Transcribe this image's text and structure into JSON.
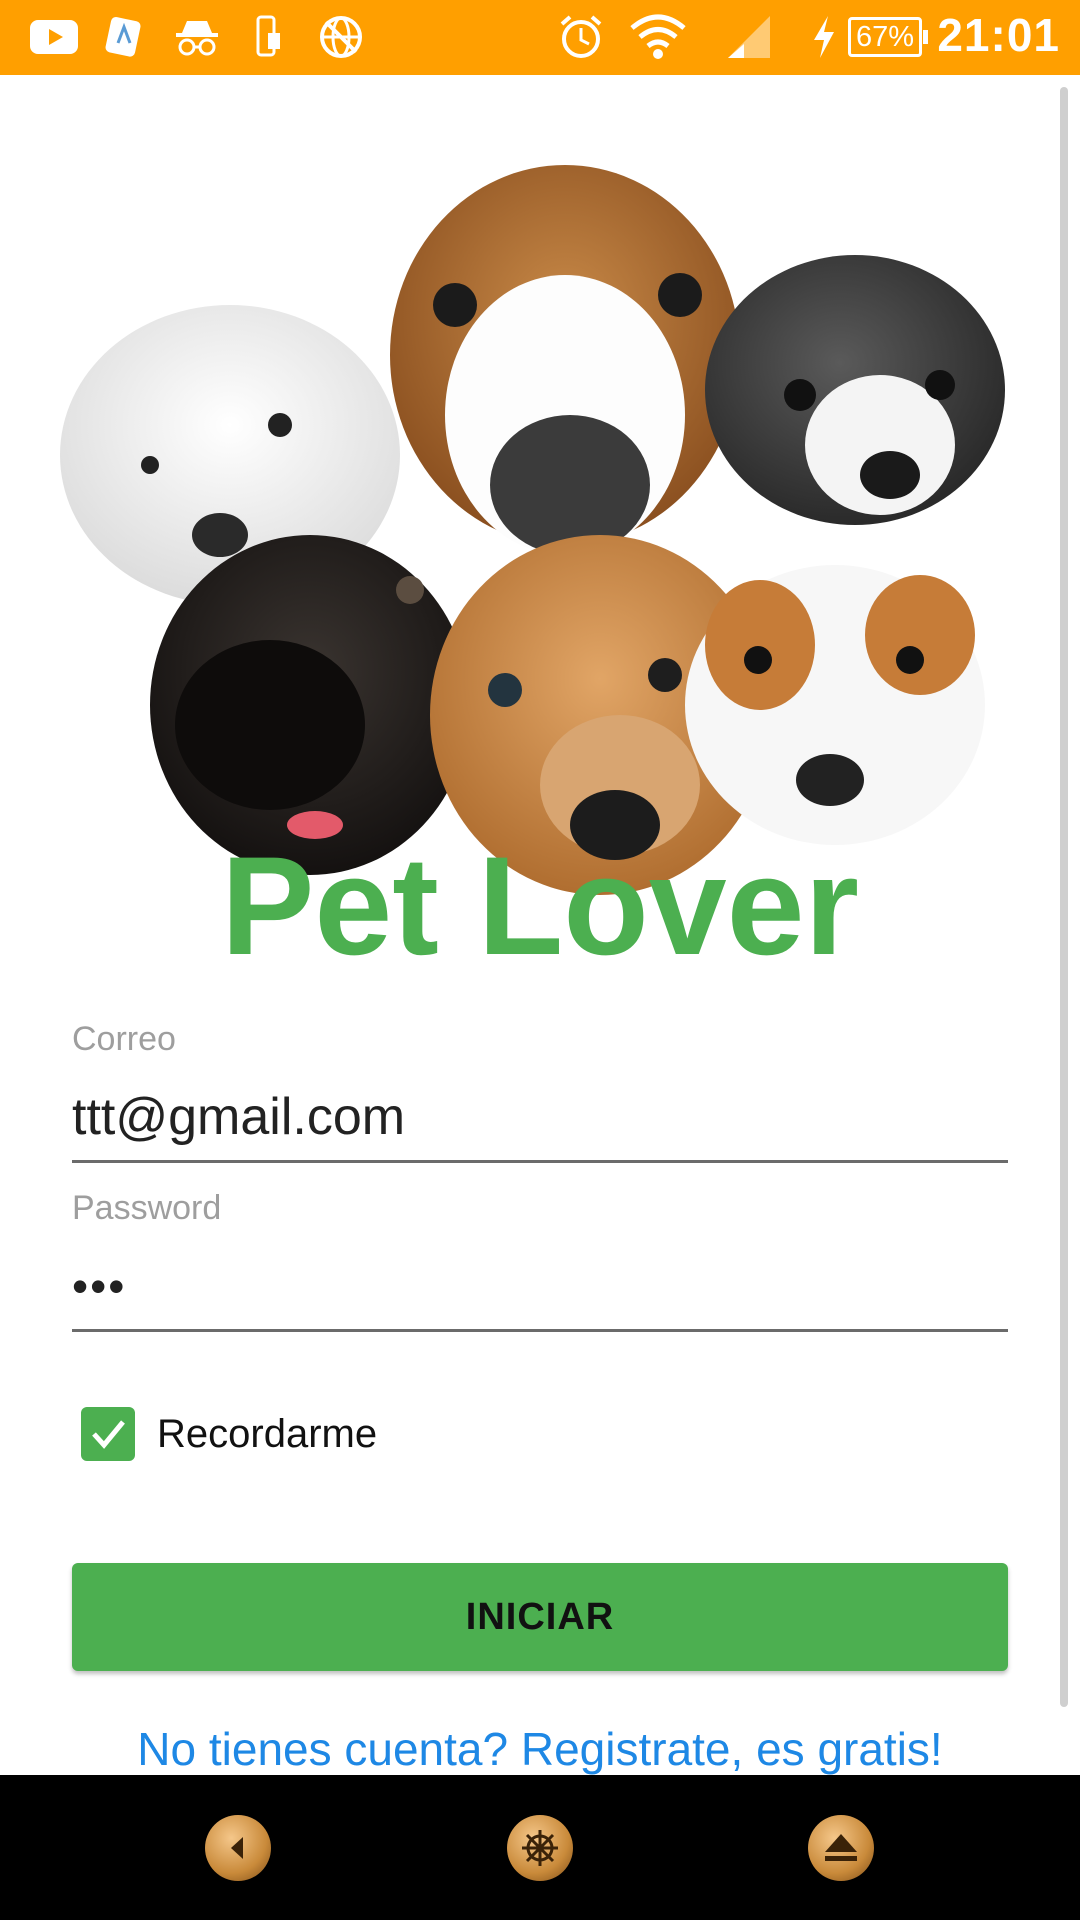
{
  "status_bar": {
    "time": "21:01",
    "battery": "67%",
    "background_color": "#ff9f00",
    "icons": [
      "youtube-icon",
      "signal-app-icon",
      "incognito-icon",
      "phone-sim-icon",
      "globe-icon",
      "alarm-icon",
      "wifi-icon",
      "cell-signal-icon",
      "charging-icon"
    ]
  },
  "app": {
    "title": "Pet Lover",
    "brand_color": "#4caf50",
    "link_color": "#1e88e5"
  },
  "form": {
    "email_label": "Correo",
    "email_value": "ttt@gmail.com",
    "password_label": "Password",
    "password_value": "•••",
    "remember_label": "Recordarme",
    "remember_checked": true,
    "submit_label": "INICIAR",
    "register_link": "No tienes cuenta? Registrate, es gratis!"
  },
  "nav_bar": {
    "buttons": [
      "back-icon",
      "home-wheel-icon",
      "up-icon"
    ]
  }
}
